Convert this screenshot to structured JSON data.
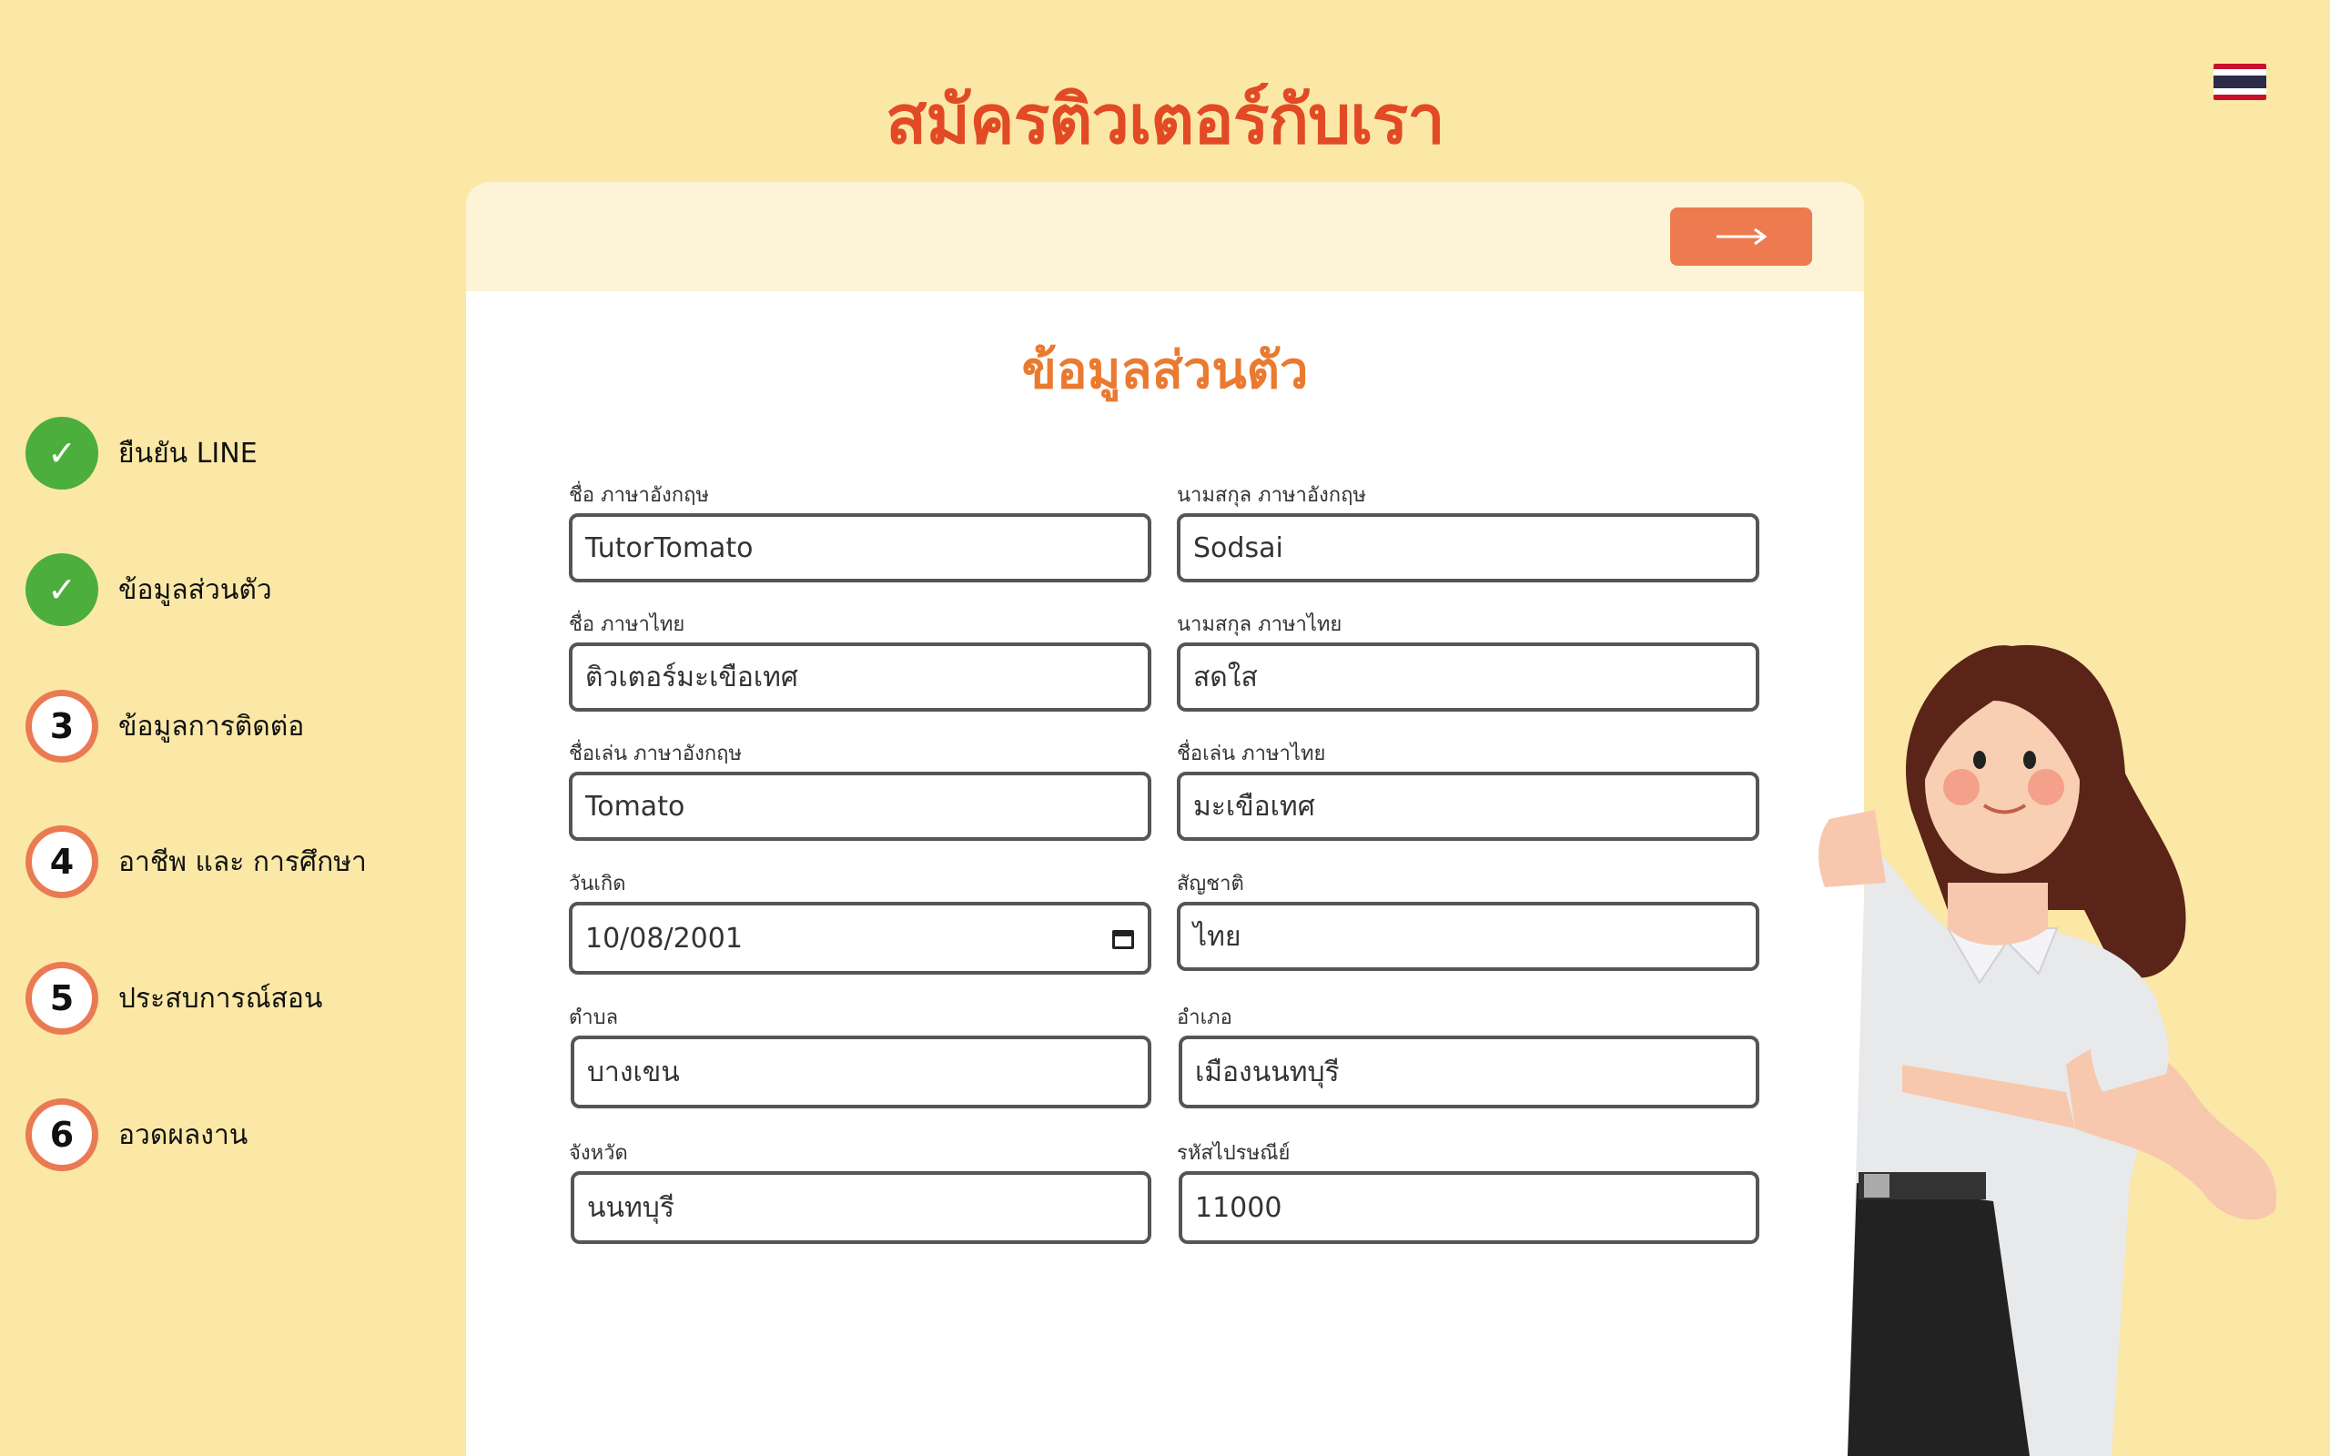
{
  "page": {
    "title": "สมัครติวเตอร์กับเรา"
  },
  "language_flag": "thailand-flag-icon",
  "steps": [
    {
      "marker": "✓",
      "label": "ยืนยัน LINE",
      "status": "done"
    },
    {
      "marker": "✓",
      "label": "ข้อมูลส่วนตัว",
      "status": "done"
    },
    {
      "marker": "3",
      "label": "ข้อมูลการติดต่อ",
      "status": "todo"
    },
    {
      "marker": "4",
      "label": "อาชีพ และ การศึกษา",
      "status": "todo"
    },
    {
      "marker": "5",
      "label": "ประสบการณ์สอน",
      "status": "todo"
    },
    {
      "marker": "6",
      "label": "อวดผลงาน",
      "status": "todo"
    }
  ],
  "form": {
    "section_title": "ข้อมูลส่วนตัว",
    "next_icon": "arrow-right-icon",
    "fields": {
      "first_name_en": {
        "label": "ชื่อ ภาษาอังกฤษ",
        "value": "TutorTomato"
      },
      "last_name_en": {
        "label": "นามสกุล ภาษาอังกฤษ",
        "value": "Sodsai"
      },
      "first_name_th": {
        "label": "ชื่อ ภาษาไทย",
        "value": "ติวเตอร์มะเขือเทศ"
      },
      "last_name_th": {
        "label": "นามสกุล ภาษาไทย",
        "value": "สดใส"
      },
      "nickname_en": {
        "label": "ชื่อเล่น ภาษาอังกฤษ",
        "value": "Tomato"
      },
      "nickname_th": {
        "label": "ชื่อเล่น ภาษาไทย",
        "value": "มะเขือเทศ"
      },
      "birthdate": {
        "label": "วันเกิด",
        "value": "10/08/2001"
      },
      "nationality": {
        "label": "สัญชาติ",
        "value": "ไทย"
      },
      "subdistrict": {
        "label": "ตำบล",
        "value": "บางเขน"
      },
      "district": {
        "label": "อำเภอ",
        "value": "เมืองนนทบุรี"
      },
      "province": {
        "label": "จังหวัด",
        "value": "นนทบุรี"
      },
      "postal_code": {
        "label": "รหัสไปรษณีย์",
        "value": "11000"
      }
    }
  },
  "colors": {
    "background": "#fbe8a6",
    "title": "#e14a25",
    "accent": "#ee7a50",
    "done": "#4cae3c"
  }
}
